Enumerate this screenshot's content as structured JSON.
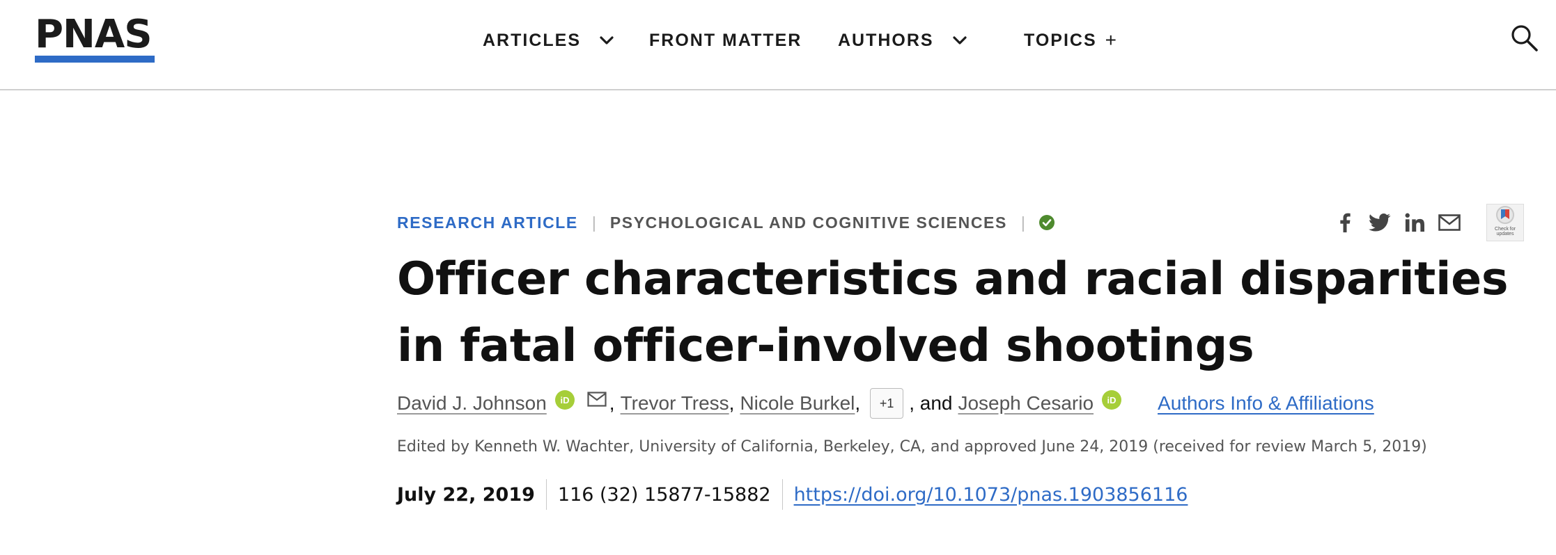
{
  "header": {
    "logo_text": "PNAS",
    "brand_color": "#2e6bc6",
    "nav": [
      {
        "label": "ARTICLES",
        "has_dropdown": true
      },
      {
        "label": "FRONT MATTER",
        "has_dropdown": false
      },
      {
        "label": "AUTHORS",
        "has_dropdown": true
      },
      {
        "label": "TOPICS",
        "has_dropdown": false,
        "suffix": "+"
      }
    ],
    "search_icon": "search-icon"
  },
  "article": {
    "type": "RESEARCH ARTICLE",
    "separator": "|",
    "subject": "PSYCHOLOGICAL AND COGNITIVE SCIENCES",
    "open_access_icon": "check-circle-icon",
    "share_icons": [
      "facebook-icon",
      "twitter-icon",
      "linkedin-icon",
      "email-icon"
    ],
    "crossmark_text": "Check for updates",
    "title": "Officer characteristics and racial disparities in fatal officer-involved shootings",
    "authors": {
      "first": "David J. Johnson",
      "second": "Trevor Tress",
      "third": "Nicole Burkel",
      "more_label": "+1",
      "conjunction": ", and",
      "last": "Joseph Cesario",
      "comma": ",",
      "affiliations_label": "Authors Info & Affiliations"
    },
    "edited_by": "Edited by Kenneth W. Wachter, University of California, Berkeley, CA, and approved June 24, 2019 (received for review March 5, 2019)",
    "publication": {
      "date": "July 22, 2019",
      "citation": "116 (32) 15877-15882",
      "doi": "https://doi.org/10.1073/pnas.1903856116"
    },
    "colors": {
      "link": "#2e6bc6",
      "orcid": "#a6ce39",
      "open_access": "#4e8a2e"
    }
  }
}
